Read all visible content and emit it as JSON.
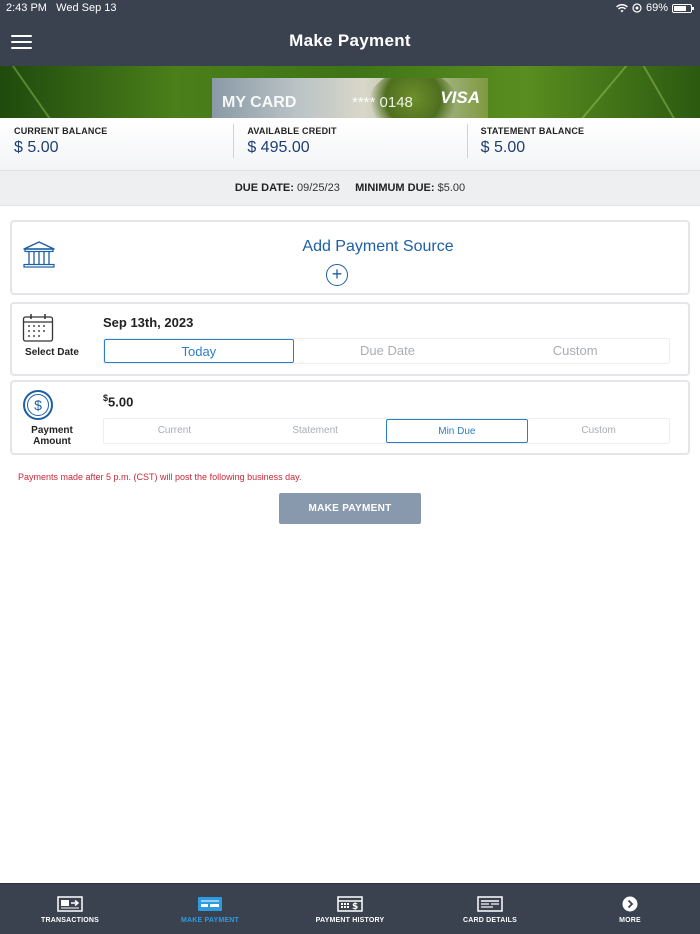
{
  "status_bar": {
    "time": "2:43 PM",
    "date": "Wed Sep 13",
    "battery": "69%"
  },
  "header": {
    "title": "Make Payment",
    "menu_icon": "hamburger-menu-icon"
  },
  "card": {
    "name": "MY CARD",
    "number": "**** 0148",
    "brand": "VISA"
  },
  "balances": [
    {
      "label": "CURRENT BALANCE",
      "value": "$ 5.00"
    },
    {
      "label": "AVAILABLE CREDIT",
      "value": "$ 495.00"
    },
    {
      "label": "STATEMENT BALANCE",
      "value": "$ 5.00"
    }
  ],
  "due": {
    "due_date_label": "DUE DATE:",
    "due_date_value": "09/25/23",
    "min_due_label": "MINIMUM DUE:",
    "min_due_value": "$5.00"
  },
  "payment_source": {
    "title": "Add Payment Source",
    "icon": "bank-icon",
    "add_icon": "plus-circle-icon"
  },
  "select_date": {
    "label": "Select Date",
    "value": "Sep 13th, 2023",
    "options": [
      "Today",
      "Due Date",
      "Custom"
    ],
    "selected": "Today"
  },
  "payment_amount": {
    "label": "Payment Amount",
    "currency_symbol": "$",
    "value": "5.00",
    "options": [
      "Current",
      "Statement",
      "Min Due",
      "Custom"
    ],
    "selected": "Min Due"
  },
  "notice": "Payments made after 5 p.m. (CST) will post the following business day.",
  "make_payment_button": "MAKE PAYMENT",
  "bottom_nav": [
    {
      "label": "TRANSACTIONS",
      "icon": "transactions-icon"
    },
    {
      "label": "MAKE PAYMENT",
      "icon": "card-payment-icon",
      "active": true
    },
    {
      "label": "PAYMENT HISTORY",
      "icon": "payment-history-icon"
    },
    {
      "label": "CARD DETAILS",
      "icon": "card-details-icon"
    },
    {
      "label": "MORE",
      "icon": "more-icon"
    }
  ],
  "colors": {
    "header_bg": "#3a4250",
    "accent": "#2d7ec6",
    "link_blue": "#1c5fa5",
    "balance_blue": "#1d3f73",
    "notice_red": "#c8283a",
    "button_bg": "#8898ad"
  }
}
